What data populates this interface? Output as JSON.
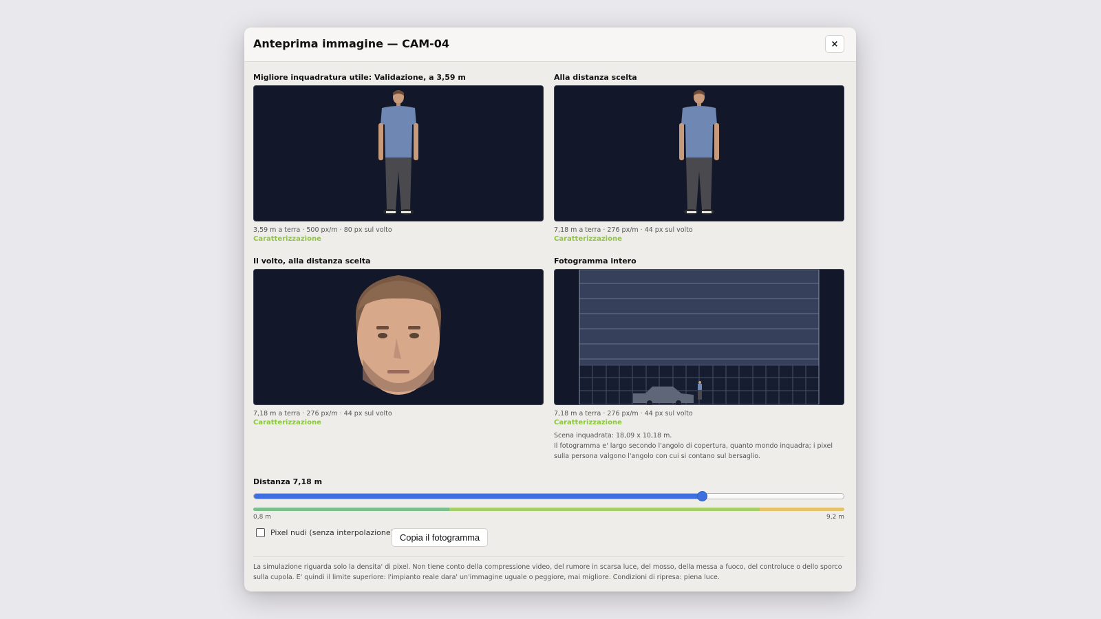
{
  "modal": {
    "title": "Anteprima immagine — CAM-04",
    "close_label": "×"
  },
  "panels": [
    {
      "label": "Migliore inquadratura utile: Validazione, a 3,59 m",
      "meta": "3,59 m a terra · 500 px/m · 80 px sul volto",
      "tag": "Caratterizzazione",
      "tag_color": "#8dc63f"
    },
    {
      "label": "Alla distanza scelta",
      "meta": "7,18 m a terra · 276 px/m · 44 px sul volto",
      "tag": "Caratterizzazione",
      "tag_color": "#8dc63f"
    },
    {
      "label": "Il volto, alla distanza scelta",
      "meta": "7,18 m a terra · 276 px/m · 44 px sul volto",
      "tag": "Caratterizzazione",
      "tag_color": "#8dc63f"
    },
    {
      "label": "Fotogramma intero",
      "meta": "7,18 m a terra · 276 px/m · 44 px sul volto",
      "tag": "Caratterizzazione",
      "tag_color": "#8dc63f",
      "scene": "Scena inquadrata: 18,09 x 10,18 m.",
      "explanation": "Il fotogramma e' largo secondo l'angolo di copertura, quanto mondo inquadra; i pixel sulla persona valgono l'angolo con cui si contano sul bersaglio."
    }
  ],
  "distance": {
    "label": "Distanza 7,18 m",
    "value_m": 7.18,
    "min_m": 0.8,
    "max_m": 9.2,
    "min_label": "0,8 m",
    "max_label": "9,2 m",
    "zones": [
      {
        "to_m": 3.59,
        "color": "#7dbf8c"
      },
      {
        "to_m": 8.0,
        "color": "#a6cf6a"
      },
      {
        "to_m": 9.2,
        "color": "#e3c26a"
      }
    ],
    "accent_color": "#3d6fe0"
  },
  "controls": {
    "raw_pixels_label": "Pixel nudi (senza interpolazione)",
    "raw_pixels_checked": false,
    "copy_frame_label": "Copia il fotogramma"
  },
  "disclaimer": "La simulazione riguarda solo la densita' di pixel. Non tiene conto della compressione video, del rumore in scarsa luce, del mosso, della messa a fuoco, del controluce o dello sporco sulla cupola. E' quindi il limite superiore: l'impianto reale dara' un'immagine uguale o peggiore, mai migliore. Condizioni di ripresa: piena luce."
}
